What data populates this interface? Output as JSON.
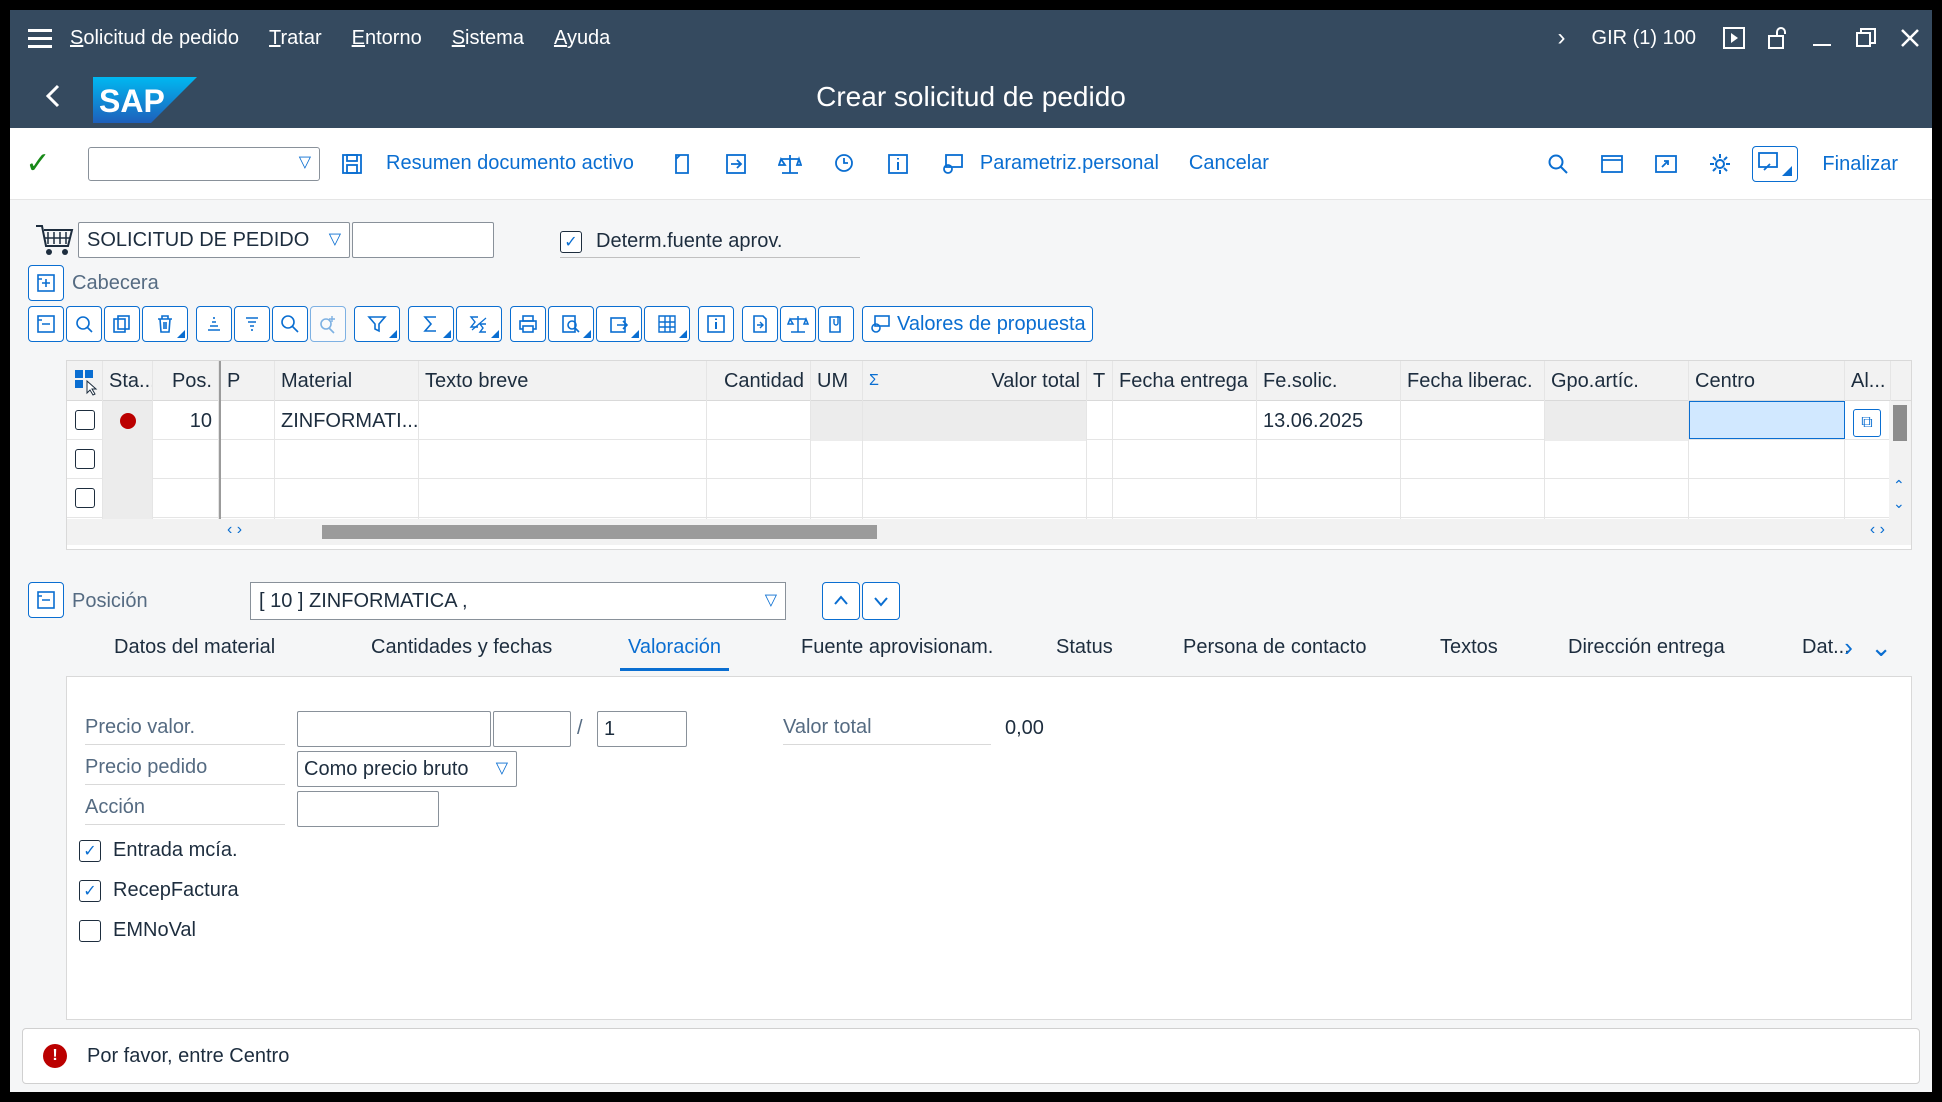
{
  "menu": {
    "items": [
      "Solicitud de pedido",
      "Tratar",
      "Entorno",
      "Sistema",
      "Ayuda"
    ],
    "system_info": "GIR (1) 100"
  },
  "titlebar": {
    "title": "Crear solicitud de pedido",
    "logo_text": "SAP"
  },
  "toolbar": {
    "command_value": "",
    "resumen_label": "Resumen documento activo",
    "param_label": "Parametriz.personal",
    "cancel_label": "Cancelar",
    "finish_label": "Finalizar"
  },
  "header": {
    "doc_type": "SOLICITUD DE PEDIDO",
    "doc_number": "",
    "determ_label": "Determ.fuente aprov.",
    "determ_checked": true,
    "cabecera_label": "Cabecera"
  },
  "grid_toolbar": {
    "propuesta_label": "Valores de propuesta"
  },
  "table": {
    "columns": [
      "Sta...",
      "Pos.",
      "P",
      "Material",
      "Texto breve",
      "Cantidad",
      "UM",
      "Σ",
      "Valor total",
      "T",
      "Fecha entrega",
      "Fe.solic.",
      "Fecha liberac.",
      "Gpo.artíc.",
      "Centro",
      "Al..."
    ],
    "rows": [
      {
        "pos": "10",
        "material": "ZINFORMATI...",
        "fe_solic": "13.06.2025",
        "status": "error"
      },
      {
        "pos": "",
        "material": "",
        "fe_solic": ""
      },
      {
        "pos": "",
        "material": "",
        "fe_solic": ""
      }
    ]
  },
  "position": {
    "label": "Posición",
    "selected": "[ 10 ] ZINFORMATICA ,"
  },
  "tabs": [
    "Datos del material",
    "Cantidades y fechas",
    "Valoración",
    "Fuente aprovisionam.",
    "Status",
    "Persona de contacto",
    "Textos",
    "Dirección entrega",
    "Dat..."
  ],
  "active_tab": "Valoración",
  "valoracion": {
    "precio_valor_label": "Precio valor.",
    "precio_valor": "",
    "moneda": "",
    "separator": "/",
    "por": "1",
    "valor_total_label": "Valor total",
    "valor_total": "0,00",
    "precio_pedido_label": "Precio pedido",
    "precio_pedido": "Como precio bruto",
    "accion_label": "Acción",
    "accion": "",
    "entrada_label": "Entrada mcía.",
    "entrada_checked": true,
    "recep_label": "RecepFactura",
    "recep_checked": true,
    "emnoval_label": "EMNoVal",
    "emnoval_checked": false
  },
  "message": {
    "text": "Por favor, entre Centro",
    "type": "error"
  },
  "colors": {
    "shell": "#354a5f",
    "accent": "#0a6ed1",
    "error": "#bb0000",
    "ok": "#188918"
  }
}
